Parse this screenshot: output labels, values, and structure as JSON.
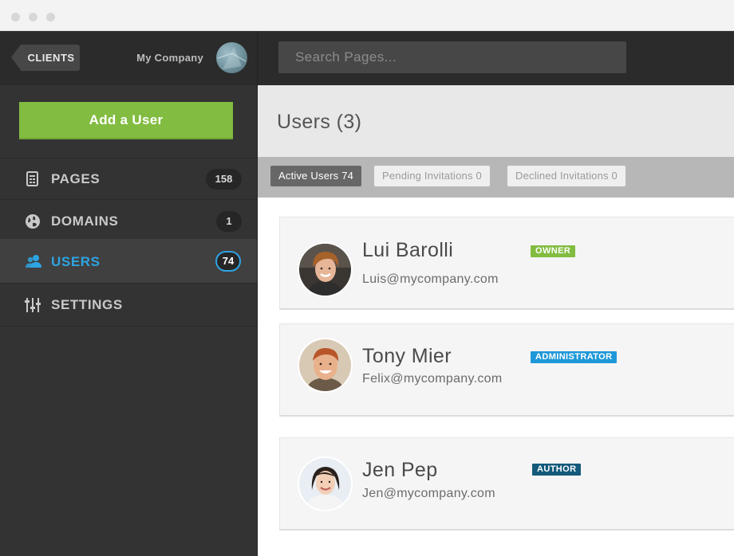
{
  "sidebar": {
    "clients_label": "CLIENTS",
    "company_name": "My Company",
    "add_user_label": "Add a User",
    "items": [
      {
        "label": "PAGES",
        "count": "158",
        "icon": "pages-icon"
      },
      {
        "label": "DOMAINS",
        "count": "1",
        "icon": "globe-icon"
      },
      {
        "label": "USERS",
        "count": "74",
        "icon": "users-icon",
        "active": true
      },
      {
        "label": "SETTINGS",
        "icon": "sliders-icon"
      }
    ]
  },
  "search": {
    "placeholder": "Search Pages..."
  },
  "header": {
    "title": "Users (3)"
  },
  "tabs": [
    {
      "label": "Active Users",
      "count": "74"
    },
    {
      "label": "Pending Invitations",
      "count": "0"
    },
    {
      "label": "Declined Invitations",
      "count": "0"
    }
  ],
  "users": [
    {
      "name": "Lui Barolli",
      "email": "Luis@mycompany.com",
      "role": "OWNER",
      "role_color": "#82bc41"
    },
    {
      "name": "Tony Mier",
      "email": "Felix@mycompany.com",
      "role": "ADMINISTRATOR",
      "role_color": "#1e98d8"
    },
    {
      "name": "Jen Pep",
      "email": "Jen@mycompany.com",
      "role": "AUTHOR",
      "role_color": "#145a7a"
    }
  ],
  "colors": {
    "accent_blue": "#2ea4e2",
    "brand_green": "#82bc41",
    "sidebar_bg": "#333333"
  }
}
